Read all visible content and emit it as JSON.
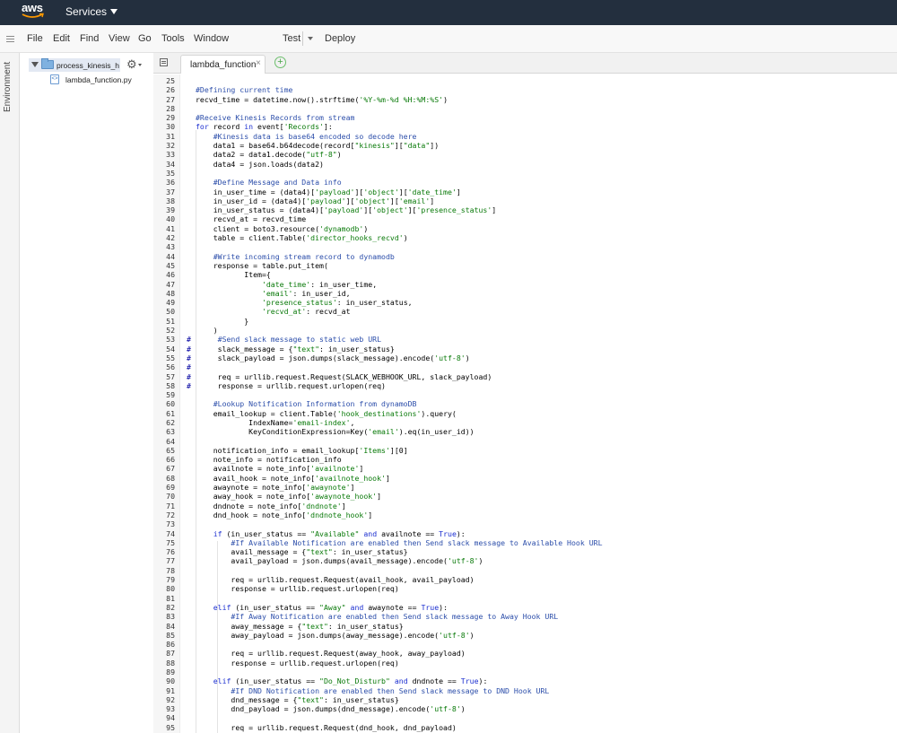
{
  "topbar": {
    "logo_text": "aws",
    "services_label": "Services"
  },
  "menubar": {
    "items": [
      "File",
      "Edit",
      "Find",
      "View",
      "Go",
      "Tools",
      "Window"
    ],
    "test_label": "Test",
    "deploy_label": "Deploy"
  },
  "sidebar": {
    "environment_label": "Environment",
    "folder_name": "process_kinesis_hooks",
    "file_name": "lambda_function.py"
  },
  "tabs": [
    {
      "label": "lambda_function",
      "close": "×"
    }
  ],
  "tab_add": "+",
  "editor": {
    "lines": [
      {
        "n": "25",
        "h": "",
        "t": ""
      },
      {
        "n": "26",
        "h": "",
        "t": "#Defining current time"
      },
      {
        "n": "27",
        "h": "",
        "t": "recvd_time = datetime.now().strftime('%Y-%m-%d %H:%M:%S')"
      },
      {
        "n": "28",
        "h": "",
        "t": ""
      },
      {
        "n": "29",
        "h": "",
        "t": "#Receive Kinesis Records from stream"
      },
      {
        "n": "30",
        "h": "",
        "t": "for record in event['Records']:"
      },
      {
        "n": "31",
        "h": "",
        "t": "    #Kinesis data is base64 encoded so decode here"
      },
      {
        "n": "32",
        "h": "",
        "t": "    data1 = base64.b64decode(record[\"kinesis\"][\"data\"])"
      },
      {
        "n": "33",
        "h": "",
        "t": "    data2 = data1.decode(\"utf-8\")"
      },
      {
        "n": "34",
        "h": "",
        "t": "    data4 = json.loads(data2)"
      },
      {
        "n": "35",
        "h": "",
        "t": ""
      },
      {
        "n": "36",
        "h": "",
        "t": "    #Define Message and Data info"
      },
      {
        "n": "37",
        "h": "",
        "t": "    in_user_time = (data4)['payload']['object']['date_time']"
      },
      {
        "n": "38",
        "h": "",
        "t": "    in_user_id = (data4)['payload']['object']['email']"
      },
      {
        "n": "39",
        "h": "",
        "t": "    in_user_status = (data4)['payload']['object']['presence_status']"
      },
      {
        "n": "40",
        "h": "",
        "t": "    recvd_at = recvd_time"
      },
      {
        "n": "41",
        "h": "",
        "t": "    client = boto3.resource('dynamodb')"
      },
      {
        "n": "42",
        "h": "",
        "t": "    table = client.Table('director_hooks_recvd')"
      },
      {
        "n": "43",
        "h": "",
        "t": ""
      },
      {
        "n": "44",
        "h": "",
        "t": "    #Write incoming stream record to dynamodb"
      },
      {
        "n": "45",
        "h": "",
        "t": "    response = table.put_item("
      },
      {
        "n": "46",
        "h": "",
        "t": "           Item={"
      },
      {
        "n": "47",
        "h": "",
        "t": "               'date_time': in_user_time,"
      },
      {
        "n": "48",
        "h": "",
        "t": "               'email': in_user_id,"
      },
      {
        "n": "49",
        "h": "",
        "t": "               'presence_status': in_user_status,"
      },
      {
        "n": "50",
        "h": "",
        "t": "               'recvd_at': recvd_at"
      },
      {
        "n": "51",
        "h": "",
        "t": "           }"
      },
      {
        "n": "52",
        "h": "",
        "t": "    )"
      },
      {
        "n": "53",
        "h": "#",
        "t": "     #Send slack message to static web URL"
      },
      {
        "n": "54",
        "h": "#",
        "t": "     slack_message = {\"text\": in_user_status}"
      },
      {
        "n": "55",
        "h": "#",
        "t": "     slack_payload = json.dumps(slack_message).encode('utf-8')"
      },
      {
        "n": "56",
        "h": "#",
        "t": ""
      },
      {
        "n": "57",
        "h": "#",
        "t": "     req = urllib.request.Request(SLACK_WEBHOOK_URL, slack_payload)"
      },
      {
        "n": "58",
        "h": "#",
        "t": "     response = urllib.request.urlopen(req)"
      },
      {
        "n": "59",
        "h": "",
        "t": ""
      },
      {
        "n": "60",
        "h": "",
        "t": "    #Lookup Notification Information from dynamoDB"
      },
      {
        "n": "61",
        "h": "",
        "t": "    email_lookup = client.Table('hook_destinations').query("
      },
      {
        "n": "62",
        "h": "",
        "t": "            IndexName='email-index',"
      },
      {
        "n": "63",
        "h": "",
        "t": "            KeyConditionExpression=Key('email').eq(in_user_id))"
      },
      {
        "n": "64",
        "h": "",
        "t": ""
      },
      {
        "n": "65",
        "h": "",
        "t": "    notification_info = email_lookup['Items'][0]"
      },
      {
        "n": "66",
        "h": "",
        "t": "    note_info = notification_info"
      },
      {
        "n": "67",
        "h": "",
        "t": "    availnote = note_info['availnote']"
      },
      {
        "n": "68",
        "h": "",
        "t": "    avail_hook = note_info['availnote_hook']"
      },
      {
        "n": "69",
        "h": "",
        "t": "    awaynote = note_info['awaynote']"
      },
      {
        "n": "70",
        "h": "",
        "t": "    away_hook = note_info['awaynote_hook']"
      },
      {
        "n": "71",
        "h": "",
        "t": "    dndnote = note_info['dndnote']"
      },
      {
        "n": "72",
        "h": "",
        "t": "    dnd_hook = note_info['dndnote_hook']"
      },
      {
        "n": "73",
        "h": "",
        "t": ""
      },
      {
        "n": "74",
        "h": "",
        "t": "    if (in_user_status == \"Available\" and availnote == True):"
      },
      {
        "n": "75",
        "h": "",
        "t": "        #If Available Notification are enabled then Send slack message to Available Hook URL"
      },
      {
        "n": "76",
        "h": "",
        "t": "        avail_message = {\"text\": in_user_status}"
      },
      {
        "n": "77",
        "h": "",
        "t": "        avail_payload = json.dumps(avail_message).encode('utf-8')"
      },
      {
        "n": "78",
        "h": "",
        "t": ""
      },
      {
        "n": "79",
        "h": "",
        "t": "        req = urllib.request.Request(avail_hook, avail_payload)"
      },
      {
        "n": "80",
        "h": "",
        "t": "        response = urllib.request.urlopen(req)"
      },
      {
        "n": "81",
        "h": "",
        "t": ""
      },
      {
        "n": "82",
        "h": "",
        "t": "    elif (in_user_status == \"Away\" and awaynote == True):"
      },
      {
        "n": "83",
        "h": "",
        "t": "        #If Away Notification are enabled then Send slack message to Away Hook URL"
      },
      {
        "n": "84",
        "h": "",
        "t": "        away_message = {\"text\": in_user_status}"
      },
      {
        "n": "85",
        "h": "",
        "t": "        away_payload = json.dumps(away_message).encode('utf-8')"
      },
      {
        "n": "86",
        "h": "",
        "t": ""
      },
      {
        "n": "87",
        "h": "",
        "t": "        req = urllib.request.Request(away_hook, away_payload)"
      },
      {
        "n": "88",
        "h": "",
        "t": "        response = urllib.request.urlopen(req)"
      },
      {
        "n": "89",
        "h": "",
        "t": ""
      },
      {
        "n": "90",
        "h": "",
        "t": "    elif (in_user_status == \"Do_Not_Disturb\" and dndnote == True):"
      },
      {
        "n": "91",
        "h": "",
        "t": "        #If DND Notification are enabled then Send slack message to DND Hook URL"
      },
      {
        "n": "92",
        "h": "",
        "t": "        dnd_message = {\"text\": in_user_status}"
      },
      {
        "n": "93",
        "h": "",
        "t": "        dnd_payload = json.dumps(dnd_message).encode('utf-8')"
      },
      {
        "n": "94",
        "h": "",
        "t": ""
      },
      {
        "n": "95",
        "h": "",
        "t": "        req = urllib.request.Request(dnd_hook, dnd_payload)"
      }
    ]
  },
  "colors": {
    "topbar_bg": "#232f3e",
    "comment": "#2c4eaa",
    "string": "#0a7a0a",
    "keyword": "#1c2fd0"
  }
}
